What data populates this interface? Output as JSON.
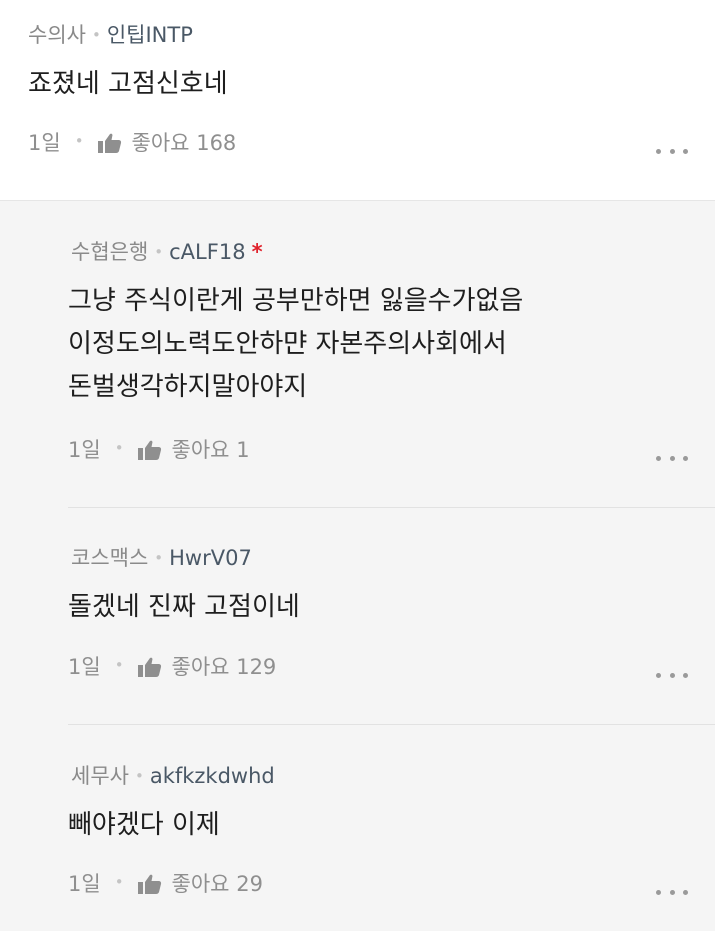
{
  "comments": [
    {
      "company": "수의사",
      "nickname": "인팁INTP",
      "lines": [
        "죠졌네 고점신호네"
      ],
      "time": "1일",
      "like_label": "좋아요",
      "like_count": "168"
    }
  ],
  "replies": [
    {
      "company": "수협은행",
      "nickname": "cALF18",
      "author_mark": "*",
      "lines": [
        "그냥 주식이란게 공부만하면 잃을수가없음",
        "이정도의노력도안하먄 자본주의사회에서",
        "돈벌생각하지말아야지"
      ],
      "time": "1일",
      "like_label": "좋아요",
      "like_count": "1"
    },
    {
      "company": "코스맥스",
      "nickname": "HwrV07",
      "lines": [
        "돌겠네 진짜 고점이네"
      ],
      "time": "1일",
      "like_label": "좋아요",
      "like_count": "129"
    },
    {
      "company": "세무사",
      "nickname": "akfkzkdwhd",
      "lines": [
        "빼야겠다 이제"
      ],
      "time": "1일",
      "like_label": "좋아요",
      "like_count": "29"
    }
  ],
  "icons": {
    "like": "thumbs-up-icon",
    "more": "more-options-icon"
  },
  "colors": {
    "author_mark": "#e0212b",
    "reply_background": "#f5f5f5"
  }
}
